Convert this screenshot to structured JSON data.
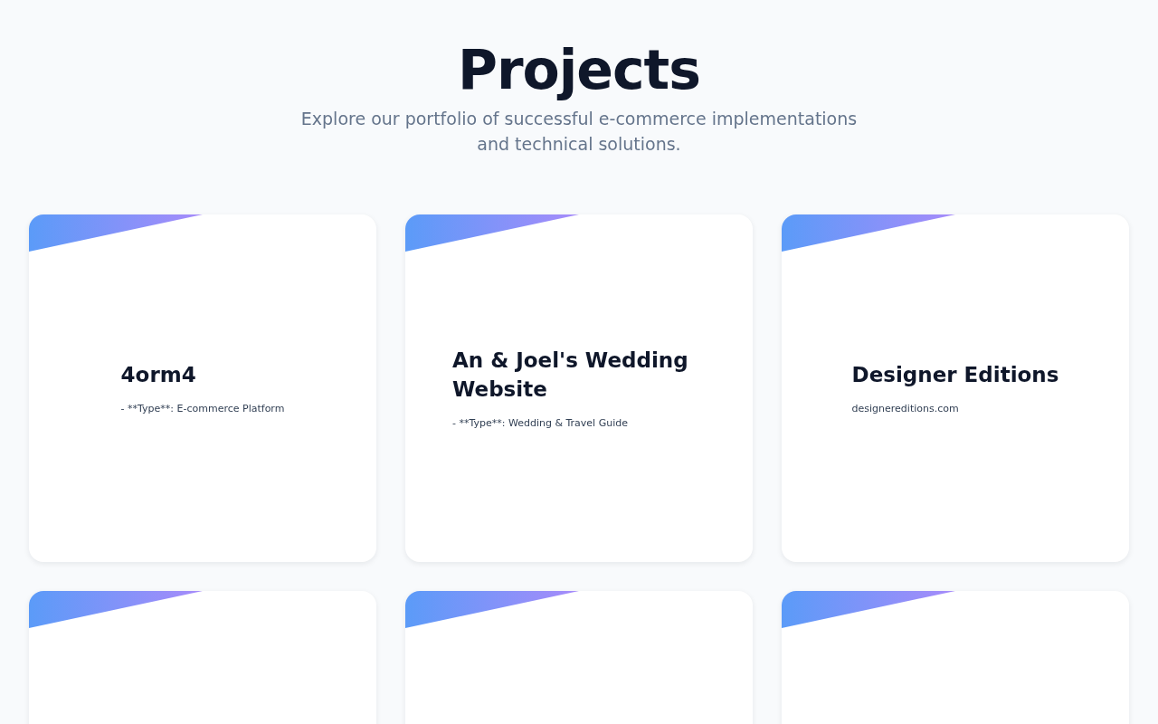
{
  "header": {
    "title": "Projects",
    "subtitle": "Explore our portfolio of successful e-commerce implementations and technical solutions."
  },
  "projects": [
    {
      "kind": "card",
      "title": "4orm4",
      "detail": "- **Type**: E-commerce Platform"
    },
    {
      "kind": "card",
      "title": "An & Joel's Wedding Website",
      "detail": "- **Type**: Wedding & Travel Guide"
    },
    {
      "kind": "card",
      "title": "Designer Editions",
      "detail": "designereditions.com"
    },
    {
      "kind": "card"
    },
    {
      "kind": "card"
    },
    {
      "kind": "card"
    }
  ]
}
